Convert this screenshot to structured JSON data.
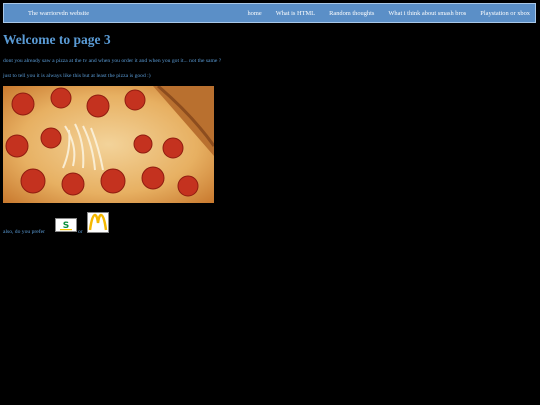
{
  "nav": {
    "brand": "The warriorvdn website",
    "links": [
      "home",
      "What is HTML",
      "Random thoughts",
      "What i think about smash bros",
      "Playstation or xbox"
    ]
  },
  "main": {
    "title": "Welcome to page 3",
    "paragraph1": "dont you already saw a pizza at the tv and when you order it and when you got it... not the same ?",
    "paragraph2": "just to tell you it is always like this but at least the pizza is good :)",
    "choice_prefix": "also, do you prefer",
    "choice_or": "or"
  },
  "icons": {
    "pizza_image": "pizza-image",
    "subway_logo": "subway-logo",
    "mcdonalds_logo": "mcdonalds-logo"
  },
  "colors": {
    "background": "#000000",
    "text": "#5a9bd5",
    "navbar": "#5b8fc7"
  }
}
